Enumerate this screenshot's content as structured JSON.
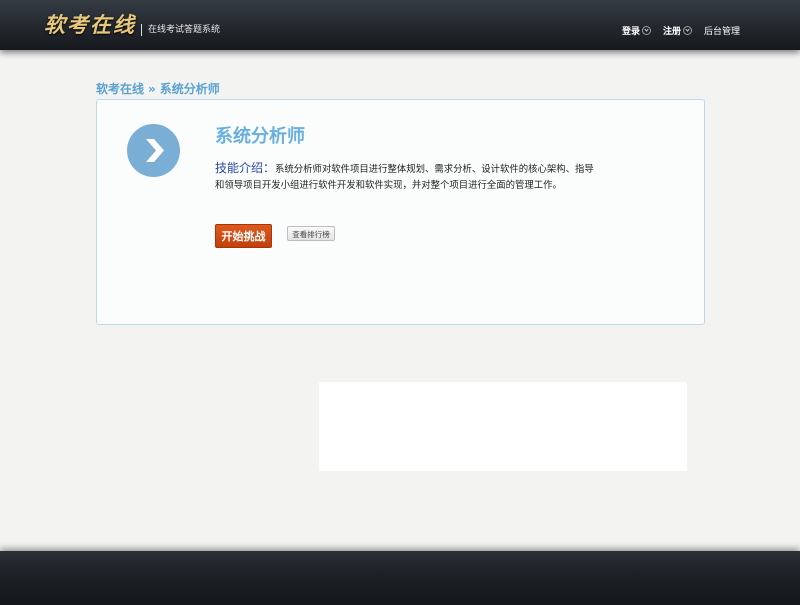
{
  "header": {
    "logo_text": "软考在线",
    "subtitle": "在线考试答题系统",
    "nav": [
      {
        "label": "登录"
      },
      {
        "label": "注册"
      },
      {
        "label": "后台管理"
      }
    ]
  },
  "breadcrumb": {
    "home": "软考在线",
    "separator": "»",
    "current": "系统分析师"
  },
  "card": {
    "icon": "chevron-right-icon",
    "title": "系统分析师",
    "desc_label": "技能介绍：",
    "desc_text": "系统分析师对软件项目进行整体规划、需求分析、设计软件的核心架构、指导和领导项目开发小组进行软件开发和软件实现，并对整个项目进行全面的管理工作。",
    "start_button": "开始挑战",
    "rank_button": "查看排行榜"
  },
  "colors": {
    "accent_blue": "#6ab0df",
    "start_orange": "#d04d13",
    "logo_gold": "#e8c97c"
  }
}
